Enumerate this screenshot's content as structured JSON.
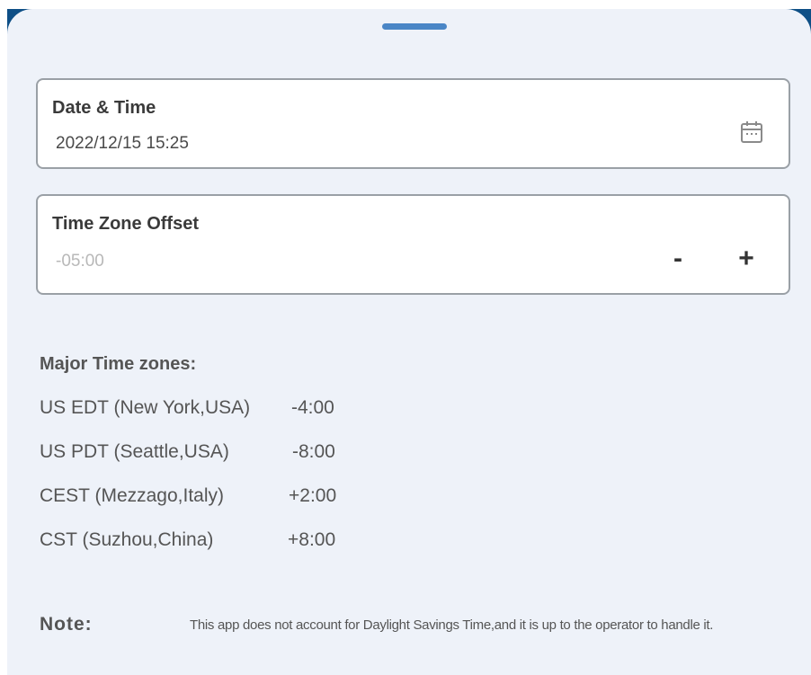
{
  "colors": {
    "sheet_background": "#eef2f9",
    "handle": "#4a86c6",
    "corner_accent": "#0e4f86",
    "field_border": "#9aa0a6"
  },
  "datetime_field": {
    "label": "Date & Time",
    "value": "2022/12/15 15:25",
    "icon": "calendar-icon"
  },
  "timezone_field": {
    "label": "Time Zone Offset",
    "placeholder": "-05:00",
    "minus_label": "-",
    "plus_label": "+"
  },
  "major_timezones": {
    "title": "Major Time zones:",
    "rows": [
      {
        "name": "US EDT (New York,USA)",
        "offset": "-4:00"
      },
      {
        "name": "US PDT (Seattle,USA)",
        "offset": "-8:00"
      },
      {
        "name": "CEST (Mezzago,Italy)",
        "offset": "+2:00"
      },
      {
        "name": "CST (Suzhou,China)",
        "offset": "+8:00"
      }
    ]
  },
  "note": {
    "label": "Note:",
    "text": "This app does not account for Daylight Savings Time,and it is up to the operator to handle it."
  }
}
